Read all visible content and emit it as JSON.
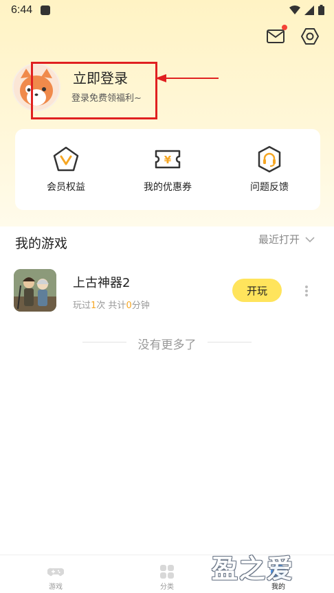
{
  "status_bar": {
    "time": "6:44"
  },
  "profile": {
    "login_title": "立即登录",
    "login_subtitle": "登录免费领福利~"
  },
  "shortcuts": [
    {
      "label": "会员权益",
      "icon": "vip-icon"
    },
    {
      "label": "我的优惠券",
      "icon": "coupon-icon"
    },
    {
      "label": "问题反馈",
      "icon": "headset-icon"
    }
  ],
  "my_games": {
    "title": "我的游戏",
    "sort_label": "最近打开",
    "games": [
      {
        "name": "上古神器2",
        "stats_prefix": "玩过",
        "play_count": "1",
        "stats_mid": "次 共计",
        "minutes": "0",
        "stats_suffix": "分钟",
        "play_label": "开玩"
      }
    ],
    "end_text": "没有更多了"
  },
  "bottom_nav": [
    {
      "label": "游戏",
      "icon": "gamepad-icon"
    },
    {
      "label": "分类",
      "icon": "category-icon"
    },
    {
      "label": "我的",
      "icon": "profile-icon"
    }
  ],
  "watermark": "盈之爱",
  "colors": {
    "accent": "#ffe45c",
    "highlight": "#f5a623",
    "annotation": "#e02020"
  }
}
